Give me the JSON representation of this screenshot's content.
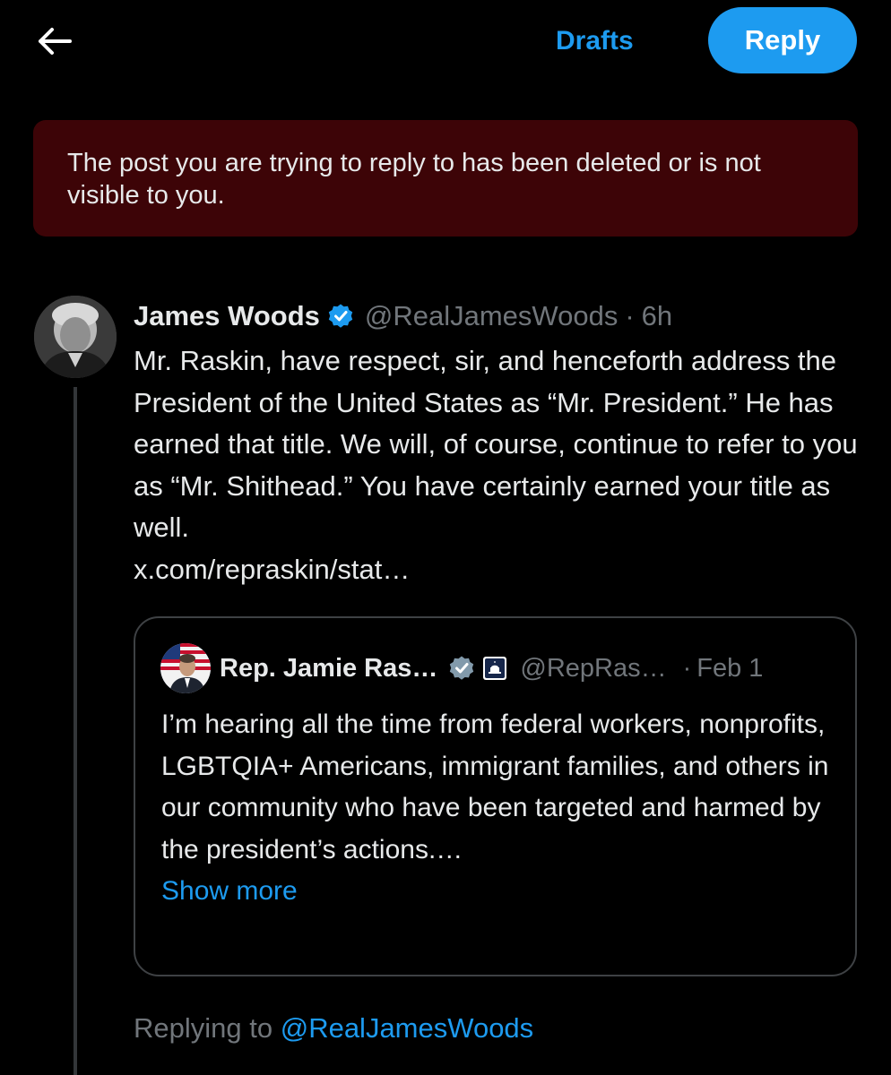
{
  "header": {
    "back_icon": "arrow-left-icon",
    "drafts_label": "Drafts",
    "reply_label": "Reply",
    "accent_color": "#1d9bf0"
  },
  "alert": {
    "message": "The post you are trying to reply to has been deleted or is not visible to you.",
    "background_color": "#3d0407"
  },
  "post": {
    "author_name": "James Woods",
    "verified_icon": "verified-badge-icon",
    "handle": "@RealJamesWoods",
    "separator": "·",
    "time": "6h",
    "text": "Mr. Raskin, have respect, sir, and henceforth address the President of the United States as “Mr. President.” He has earned that title. We will, of course, continue to refer to you as “Mr. Shithead.” You have certainly earned your title as well.",
    "link": "x.com/repraskin/stat…"
  },
  "quote": {
    "author_name": "Rep. Jamie Ras…",
    "verified_icon": "verified-badge-icon",
    "affiliation_icon": "capitol-badge-icon",
    "handle": "@RepRas…",
    "separator": "·",
    "date": "Feb 1",
    "text": "I’m hearing all the time from federal workers, nonprofits, LGBTQIA+ Americans, immigrant families, and others in our community who have been targeted and harmed by the president’s actions.…",
    "show_more": "Show more"
  },
  "reply_context": {
    "prefix": "Replying to",
    "target": "@RealJamesWoods"
  }
}
